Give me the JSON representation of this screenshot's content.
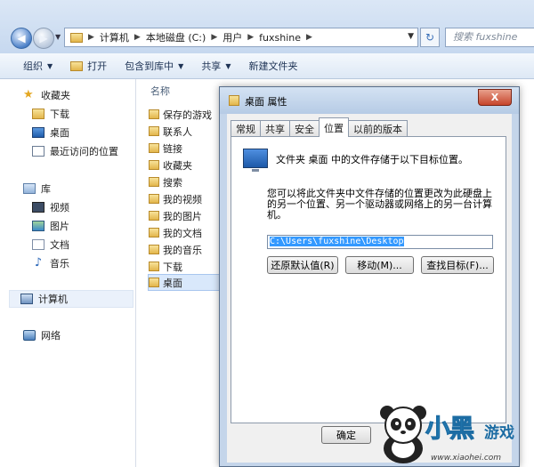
{
  "address": {
    "crumbs": [
      "计算机",
      "本地磁盘 (C:)",
      "用户",
      "fuxshine"
    ],
    "search_placeholder": "搜索 fuxshine"
  },
  "toolbar": {
    "organize": "组织",
    "open": "打开",
    "include": "包含到库中",
    "share": "共享",
    "new_folder": "新建文件夹"
  },
  "nav": {
    "favorites": "收藏夹",
    "downloads": "下载",
    "desktop": "桌面",
    "recent": "最近访问的位置",
    "libraries": "库",
    "videos": "视频",
    "pictures": "图片",
    "documents": "文档",
    "music": "音乐",
    "computer": "计算机",
    "network": "网络"
  },
  "filelist": {
    "col_name": "名称",
    "items": [
      "保存的游戏",
      "联系人",
      "链接",
      "收藏夹",
      "搜索",
      "我的视频",
      "我的图片",
      "我的文档",
      "我的音乐",
      "下载",
      "桌面"
    ]
  },
  "dialog": {
    "title": "桌面 属性",
    "close": "X",
    "tabs": [
      "常规",
      "共享",
      "安全",
      "位置",
      "以前的版本"
    ],
    "active_tab": "位置",
    "headline": "文件夹 桌面 中的文件存储于以下目标位置。",
    "description": "您可以将此文件夹中文件存储的位置更改为此硬盘上的另一个位置、另一个驱动器或网络上的另一台计算机。",
    "path": "C:\\Users\\fuxshine\\Desktop",
    "buttons": {
      "restore": "还原默认值(R)",
      "move": "移动(M)...",
      "find": "查找目标(F)...",
      "ok": "确定"
    }
  },
  "watermark": {
    "logo": "小黑",
    "logo_sub": "游戏",
    "url": "www.xiaohei.com"
  }
}
